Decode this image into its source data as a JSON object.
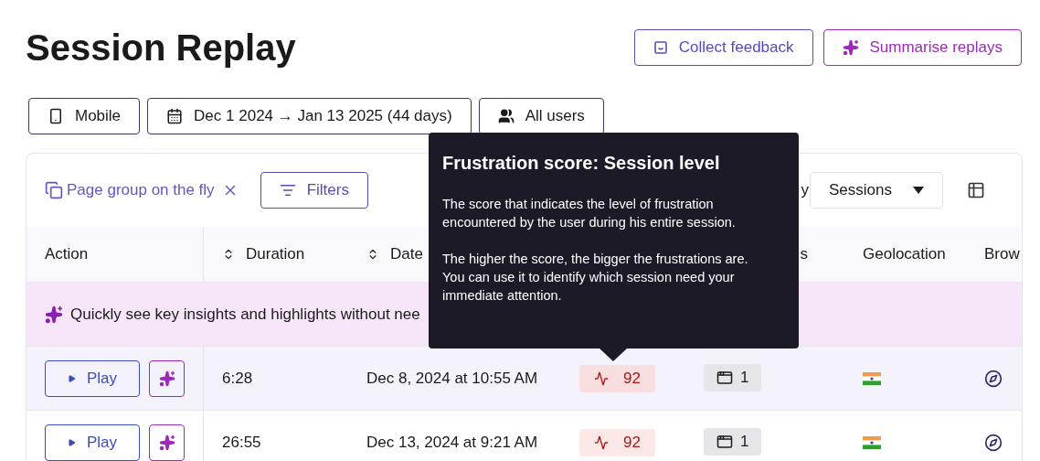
{
  "page": {
    "title": "Session Replay"
  },
  "header_buttons": [
    {
      "kind": "feedback",
      "label": "Collect feedback"
    },
    {
      "kind": "summarise",
      "label": "Summarise replays"
    }
  ],
  "filter_chips": [
    {
      "kind": "device",
      "label": "Mobile"
    },
    {
      "kind": "date",
      "label": "Dec 1 2024 → Jan 13 2025 (44 days)"
    },
    {
      "kind": "users",
      "label": "All users"
    }
  ],
  "toolbar": {
    "page_group": "Page group on the fly",
    "filters": "Filters",
    "partial_label": "y",
    "view_select": "Sessions"
  },
  "table": {
    "columns": [
      {
        "label": "Action",
        "sortable": false
      },
      {
        "label": "Duration",
        "sortable": true
      },
      {
        "label": "Date",
        "sortable": true
      },
      {},
      {
        "label": "s"
      },
      {
        "label": "Geolocation",
        "sortable": false
      },
      {
        "label": "Brow",
        "sortable": false
      }
    ],
    "banner": "Quickly see key insights and highlights without nee",
    "rows": [
      {
        "highlighted": true,
        "play": "Play",
        "duration": "6:28",
        "date": "Dec 8, 2024 at 10:55 AM",
        "score": "92",
        "pages": "1"
      },
      {
        "highlighted": false,
        "play": "Play",
        "duration": "26:55",
        "date": "Dec 13, 2024 at 9:21 AM",
        "score": "92",
        "pages": "1"
      }
    ]
  },
  "tooltip": {
    "title": "Frustration score: Session level",
    "paragraphs": [
      "The score that indicates the level of frustration encountered by the user during his entire session.",
      "The higher the score, the bigger the frustrations are. You can use it to identify which session need your immediate attention."
    ]
  }
}
